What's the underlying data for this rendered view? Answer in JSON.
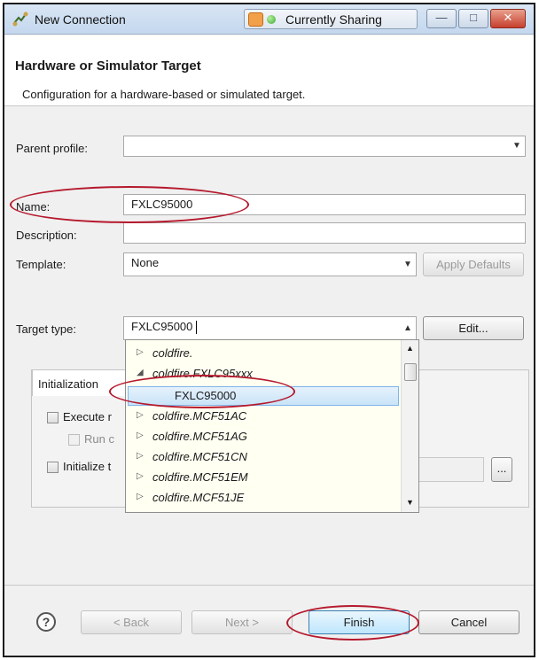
{
  "window": {
    "title": "New Connection",
    "sharing_status": "Currently Sharing",
    "minimize_symbol": "—",
    "maximize_symbol": "□",
    "close_symbol": "✕"
  },
  "header": {
    "title": "Hardware or Simulator Target",
    "description": "Configuration for a hardware-based or simulated target."
  },
  "form": {
    "parent_profile_label": "Parent profile:",
    "parent_profile_value": "",
    "name_label": "Name:",
    "name_value": "FXLC95000",
    "description_label": "Description:",
    "description_value": "",
    "template_label": "Template:",
    "template_value": "None",
    "apply_defaults_label": "Apply Defaults",
    "target_type_label": "Target type:",
    "target_type_value": "FXLC95000",
    "edit_label": "Edit..."
  },
  "dropdown": {
    "items": [
      {
        "label": "coldfire.",
        "expanded": false
      },
      {
        "label": "coldfire.FXLC95xxx",
        "expanded": true
      },
      {
        "label": "FXLC95000",
        "selected": true
      },
      {
        "label": "coldfire.MCF51AC",
        "expanded": false
      },
      {
        "label": "coldfire.MCF51AG",
        "expanded": false
      },
      {
        "label": "coldfire.MCF51CN",
        "expanded": false
      },
      {
        "label": "coldfire.MCF51EM",
        "expanded": false
      },
      {
        "label": "coldfire.MCF51JE",
        "expanded": false
      }
    ]
  },
  "initialization": {
    "tab_label": "Initialization",
    "execute_label_partial": "Execute r",
    "run_label_partial": "Run c",
    "initialize_label_partial": "Initialize t",
    "browse_label": "..."
  },
  "footer": {
    "back_label": "< Back",
    "next_label": "Next >",
    "finish_label": "Finish",
    "cancel_label": "Cancel",
    "help_symbol": "?"
  },
  "colors": {
    "highlight_ellipse": "#b5192d",
    "selected_item_bg": "#c9e3f8",
    "dropdown_bg": "#fffff2"
  }
}
